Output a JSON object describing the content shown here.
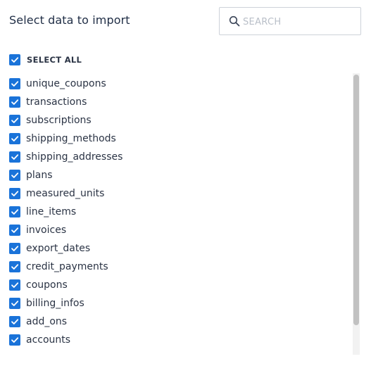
{
  "dialog": {
    "title": "Select data to import"
  },
  "search": {
    "placeholder": "SEARCH",
    "value": "",
    "icon": "search-icon"
  },
  "select_all": {
    "label": "SELECT ALL",
    "checked": true
  },
  "items": [
    {
      "label": "unique_coupons",
      "checked": true
    },
    {
      "label": "transactions",
      "checked": true
    },
    {
      "label": "subscriptions",
      "checked": true
    },
    {
      "label": "shipping_methods",
      "checked": true
    },
    {
      "label": "shipping_addresses",
      "checked": true
    },
    {
      "label": "plans",
      "checked": true
    },
    {
      "label": "measured_units",
      "checked": true
    },
    {
      "label": "line_items",
      "checked": true
    },
    {
      "label": "invoices",
      "checked": true
    },
    {
      "label": "export_dates",
      "checked": true
    },
    {
      "label": "credit_payments",
      "checked": true
    },
    {
      "label": "coupons",
      "checked": true
    },
    {
      "label": "billing_infos",
      "checked": true
    },
    {
      "label": "add_ons",
      "checked": true
    },
    {
      "label": "accounts",
      "checked": true
    }
  ],
  "colors": {
    "checkbox": "#1a73d9",
    "text": "#2b3445"
  }
}
